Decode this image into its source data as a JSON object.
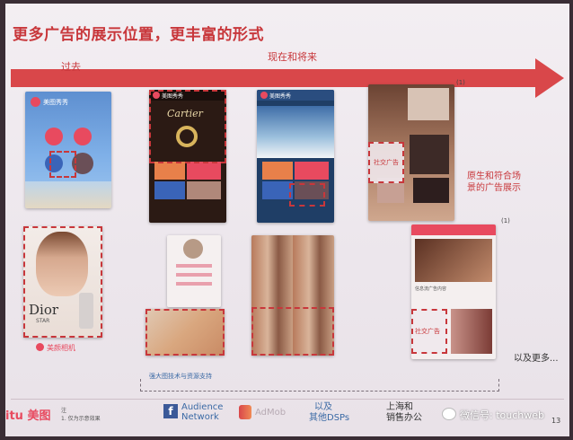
{
  "slide": {
    "title": "更多广告的展示位置，更丰富的形式",
    "past_label": "过去",
    "now_label": "现在和将来",
    "page_number": "13"
  },
  "panels": {
    "p1": {
      "app_name": "美图秀秀",
      "ad_brand": "Dior",
      "ad_sub": "STAR",
      "footer_label": "美颜相机"
    },
    "p2": {
      "app_name": "美图秀秀",
      "ad_brand": "Cartier"
    },
    "p3": {
      "app_name": "美图秀秀"
    },
    "p4": {
      "footnote_a": "(1)",
      "footnote_b": "(1)",
      "ad_tag_1": "社交广告",
      "ad_tag_2": "社交广告",
      "native_note": "原生和符合场景的广告展示",
      "bottom_caption": "信息流广告内容"
    }
  },
  "more_text": "以及更多...",
  "support_text": "强大图技术与资源支持",
  "partners": {
    "facebook_line1": "Audience",
    "facebook_line2": "Network",
    "admob": "AdMob",
    "dsp_line1": "以及",
    "dsp_line2": "其他DSPs",
    "office_line1": "上海和",
    "office_line2": "销售办公"
  },
  "footer": {
    "brand": "itu 美图",
    "note_line1": "注",
    "note_line2": "1. 仅为示意效果"
  },
  "watermark": {
    "text": "微信号: touchweb"
  },
  "colors": {
    "accent": "#c8373b",
    "arrow": "#d9474a"
  }
}
